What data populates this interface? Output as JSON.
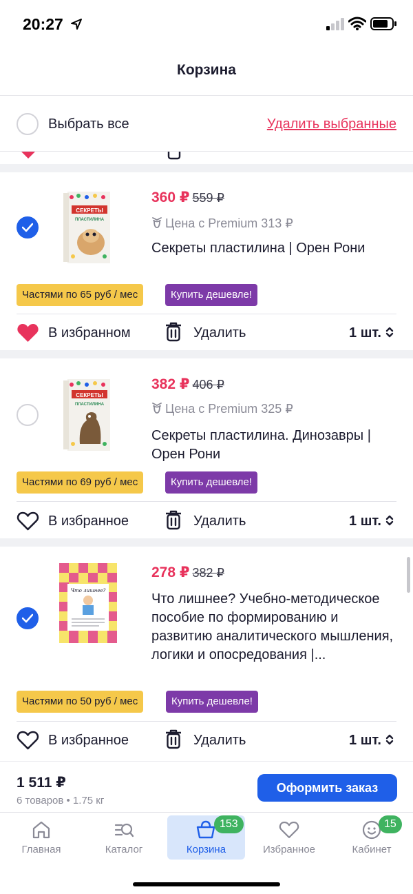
{
  "status_bar": {
    "time": "20:27"
  },
  "header": {
    "title": "Корзина"
  },
  "selection": {
    "select_all_label": "Выбрать все",
    "delete_selected_label": "Удалить выбранные"
  },
  "items": [
    {
      "price": "360 ₽",
      "old_price": "559 ₽",
      "premium_price": "Цена с Premium 313 ₽",
      "title": "Секреты пластилина | Орен Рони",
      "installment": "Частями по 65 руб / мес",
      "cheaper": "Купить дешевле!",
      "favorite_label": "В избранном",
      "delete_label": "Удалить",
      "quantity": "1 шт.",
      "selected": true,
      "favorited": true,
      "cover_text": "СЕКРЕТЫ ПЛАСТИЛИНА"
    },
    {
      "price": "382 ₽",
      "old_price": "406 ₽",
      "premium_price": "Цена с Premium 325 ₽",
      "title": "Секреты пластилина. Динозавры | Орен Рони",
      "installment": "Частями по 69 руб / мес",
      "cheaper": "Купить дешевле!",
      "favorite_label": "В избранное",
      "delete_label": "Удалить",
      "quantity": "1 шт.",
      "selected": false,
      "favorited": false,
      "cover_text": "СЕКРЕТЫ ПЛАСТИЛИНА"
    },
    {
      "price": "278 ₽",
      "old_price": "382 ₽",
      "title": "Что лишнее? Учебно-методическое пособие по формированию и развитию аналитического мышления, логики и опосредования |...",
      "installment": "Частями по 50 руб / мес",
      "cheaper": "Купить дешевле!",
      "favorite_label": "В избранное",
      "delete_label": "Удалить",
      "quantity": "1 шт.",
      "selected": true,
      "favorited": false,
      "cover_text": "Что лишнее?"
    }
  ],
  "order": {
    "total": "1 511 ₽",
    "meta": "6 товаров • 1.75 кг",
    "checkout_label": "Оформить заказ"
  },
  "tabs": [
    {
      "label": "Главная",
      "icon": "home-icon"
    },
    {
      "label": "Каталог",
      "icon": "catalog-search-icon"
    },
    {
      "label": "Корзина",
      "icon": "basket-icon",
      "badge": "153",
      "active": true
    },
    {
      "label": "Избранное",
      "icon": "heart-icon"
    },
    {
      "label": "Кабинет",
      "icon": "smile-icon",
      "badge": "15"
    }
  ],
  "colors": {
    "accent": "#1f5fe8",
    "price": "#e8335c",
    "installment": "#f5c84a",
    "cheaper": "#7d3aa8",
    "badge": "#3fb360"
  }
}
